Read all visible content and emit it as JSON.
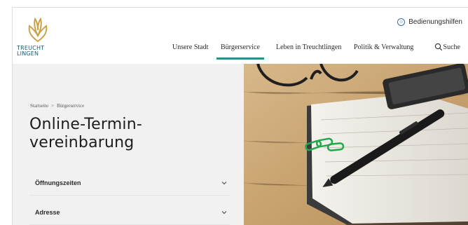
{
  "header": {
    "logo": {
      "line1": "TREUCHT",
      "line2": "LINGEN",
      "color": "#155c6b",
      "accent": "#c9a24a"
    },
    "accessibility_label": "Bedienungshilfen",
    "accessibility_icon": "accessibility-icon",
    "nav": [
      {
        "label": "Unsere Stadt",
        "active": false
      },
      {
        "label": "Bürgerservice",
        "active": true
      },
      {
        "label": "Leben in Treuchtlingen",
        "active": false
      },
      {
        "label": "Politik & Verwaltung",
        "active": false
      }
    ],
    "search_label": "Suche",
    "active_color": "#2f8f88"
  },
  "breadcrumb": {
    "items": [
      "Startseite",
      "Bürgerservice"
    ],
    "separator": ">"
  },
  "page_title": {
    "line1": "Online-Termin-",
    "line2": "vereinbarung"
  },
  "accordion": [
    {
      "label": "Öffnungszeiten",
      "icon": "chevron-down-icon"
    },
    {
      "label": "Adresse",
      "icon": "chevron-down-icon"
    }
  ]
}
